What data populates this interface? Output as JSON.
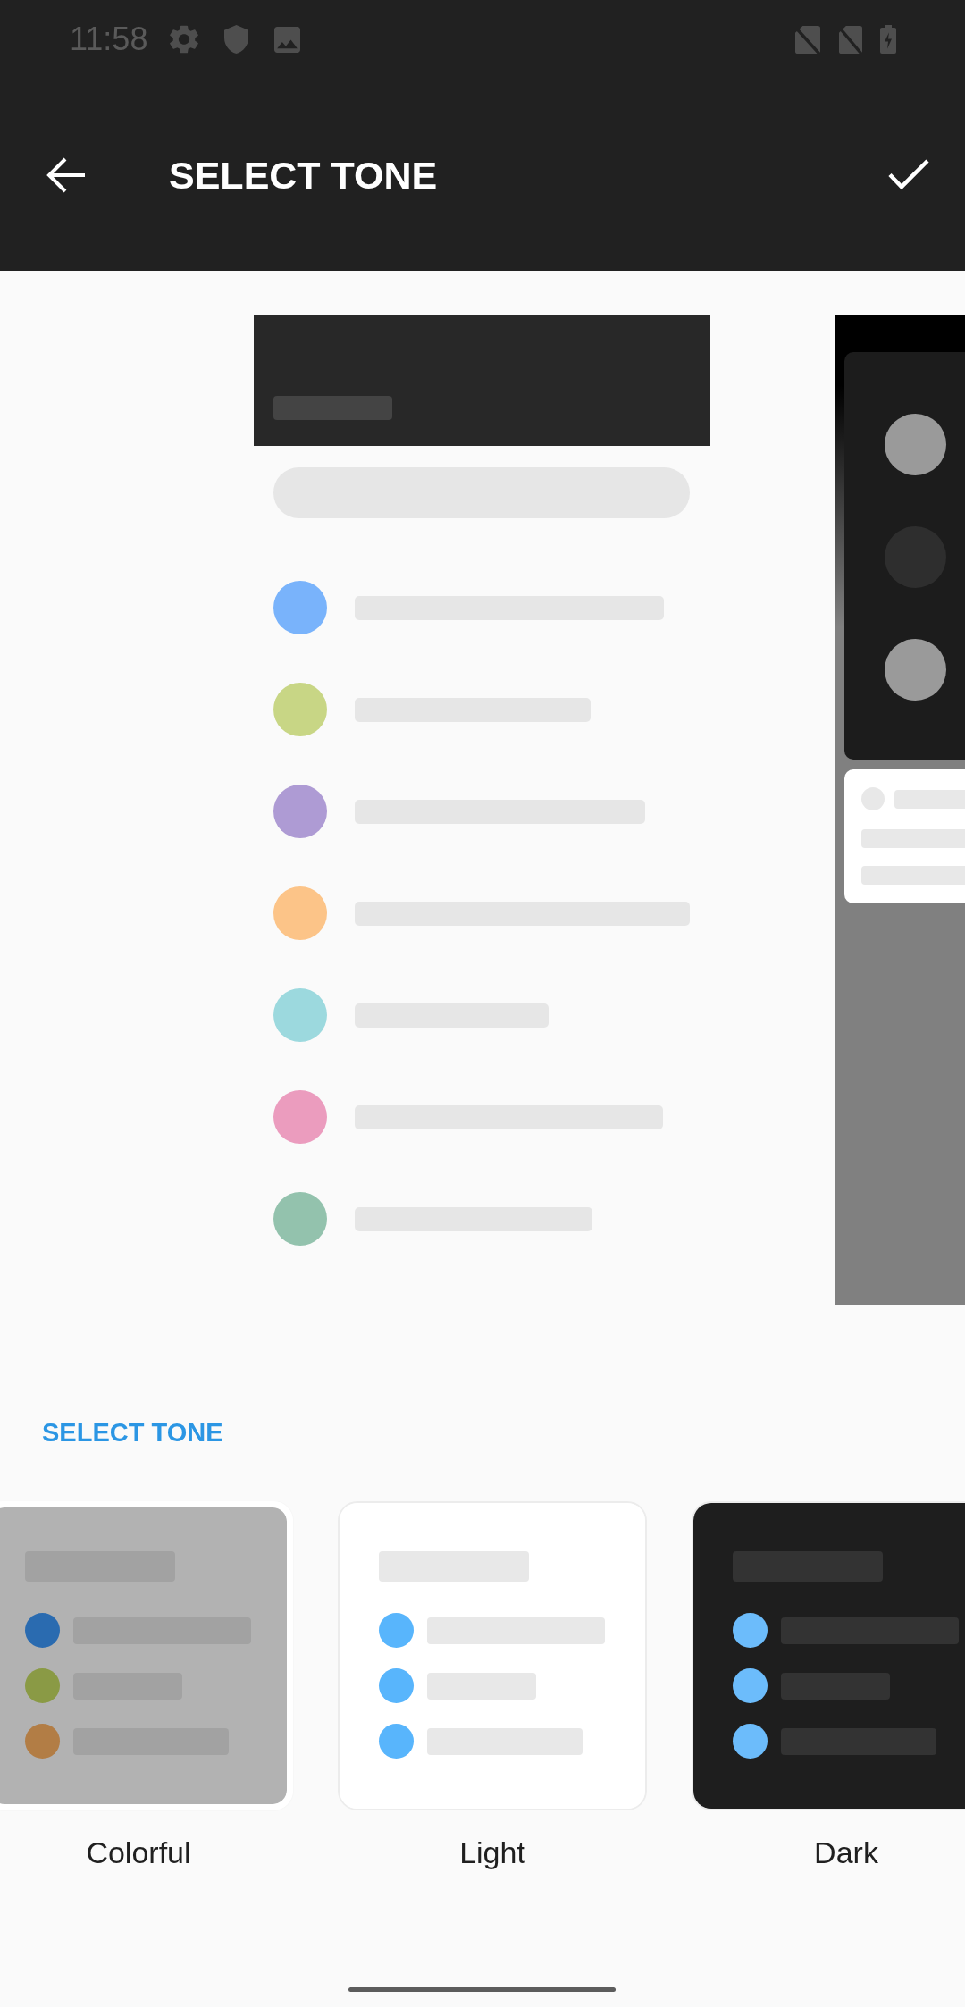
{
  "status_bar": {
    "time": "11:58"
  },
  "app_bar": {
    "title": "SELECT TONE"
  },
  "preview_pages": [
    {
      "kind": "list",
      "items": [
        {
          "color": "#79b3fb"
        },
        {
          "color": "#c8d685"
        },
        {
          "color": "#ae9bd4"
        },
        {
          "color": "#fcc488"
        },
        {
          "color": "#9cd9de"
        },
        {
          "color": "#eb9cbe"
        },
        {
          "color": "#93c2ad"
        }
      ]
    },
    {
      "kind": "panel"
    }
  ],
  "section": {
    "title": "SELECT TONE"
  },
  "tones": [
    {
      "kind": "colorful",
      "label": "Colorful",
      "selected": true
    },
    {
      "kind": "light",
      "label": "Light",
      "selected": false
    },
    {
      "kind": "dark",
      "label": "Dark",
      "selected": false
    }
  ]
}
